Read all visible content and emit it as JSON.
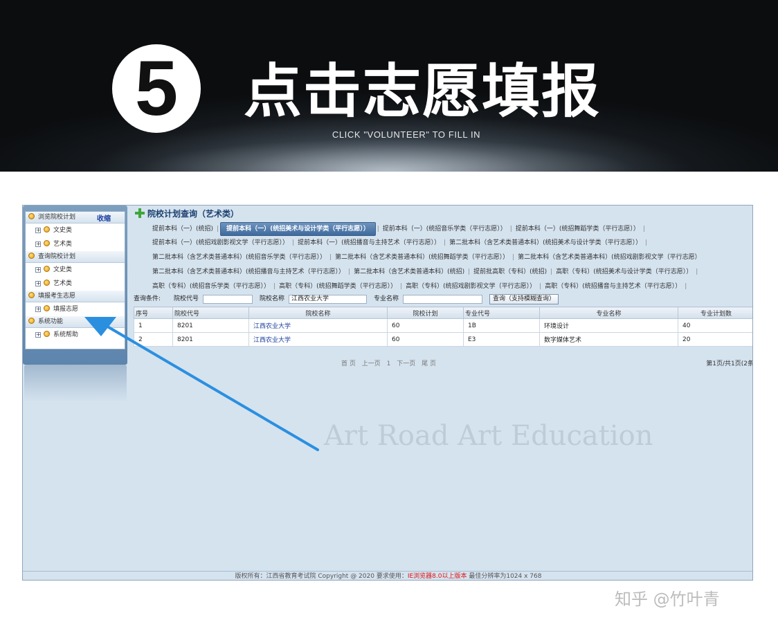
{
  "banner": {
    "step_number": "5",
    "title": "点击志愿填报",
    "subtitle": "CLICK \"VOLUNTEER\" TO FILL IN"
  },
  "sidebar": {
    "collapse_label": "收缩",
    "groups": [
      {
        "label": "浏览院校计划",
        "items": [
          {
            "label": "文史类"
          },
          {
            "label": "艺术类"
          }
        ]
      },
      {
        "label": "查询院校计划",
        "items": [
          {
            "label": "文史类"
          },
          {
            "label": "艺术类"
          }
        ]
      },
      {
        "label": "填报考生志愿",
        "items": [
          {
            "label": "填报志愿"
          }
        ]
      },
      {
        "label": "系统功能",
        "items": [
          {
            "label": "系统帮助"
          }
        ]
      }
    ]
  },
  "main": {
    "title": "院校计划查询（艺术类）",
    "tab_rows": [
      [
        "提前本科（一）(统招)",
        "提前本科（一）(统招美术与设计学类（平行志愿））",
        "提前本科（一）(统招音乐学类（平行志愿））",
        "提前本科（一）(统招舞蹈学类（平行志愿））"
      ],
      [
        "提前本科（一）(统招戏剧影视文学（平行志愿））",
        "提前本科（一）(统招播音与主持艺术（平行志愿））",
        "第二批本科（含艺术类普通本科）(统招美术与设计学类（平行志愿））"
      ],
      [
        "第二批本科（含艺术类普通本科）(统招音乐学类（平行志愿））",
        "第二批本科（含艺术类普通本科）(统招舞蹈学类（平行志愿））",
        "第二批本科（含艺术类普通本科）(统招戏剧影视文学（平行志愿）"
      ],
      [
        "第二批本科（含艺术类普通本科）(统招播音与主持艺术（平行志愿））",
        "第二批本科（含艺术类普通本科）(统招)",
        "提前批高职（专科）(统招)",
        "高职（专科）(统招美术与设计学类（平行志愿））"
      ],
      [
        "高职（专科）(统招音乐学类（平行志愿））",
        "高职（专科）(统招舞蹈学类（平行志愿））",
        "高职（专科）(统招戏剧影视文学（平行志愿））",
        "高职（专科）(统招播音与主持艺术（平行志愿））"
      ]
    ],
    "active_tab": "提前本科（一）(统招美术与设计学类（平行志愿））",
    "query": {
      "conditions_label": "查询条件:",
      "school_code_label": "院校代号",
      "school_code_value": "",
      "school_name_label": "院校名称",
      "school_name_value": "江西农业大学",
      "major_name_label": "专业名称",
      "major_name_value": "",
      "search_button": "查询（支持模糊查询）"
    },
    "table": {
      "headers": [
        "序号",
        "院校代号",
        "院校名称",
        "院校计划",
        "专业代号",
        "专业名称",
        "专业计划数"
      ],
      "rows": [
        [
          "1",
          "8201",
          "江西农业大学",
          "60",
          "1B",
          "环境设计",
          "40"
        ],
        [
          "2",
          "8201",
          "江西农业大学",
          "60",
          "E3",
          "数字媒体艺术",
          "20"
        ]
      ]
    },
    "pager": {
      "first": "首 页",
      "prev": "上一页",
      "current": "1",
      "next": "下一页",
      "last": "尾 页",
      "info": "第1页/共1页(2条"
    },
    "watermark": "Art Road Art Education"
  },
  "footer": {
    "text": "版权所有：江西省教育考试院 Copyright @ 2020 要求使用：",
    "highlight": "IE浏览器8.0以上版本",
    "tail": " 最佳分辨率为1024 x 768"
  },
  "credit": "知乎 @竹叶青",
  "colors": {
    "arrow": "#2b8fe0",
    "active_tab": "#3e6a9e",
    "link": "#1b3f9e"
  }
}
